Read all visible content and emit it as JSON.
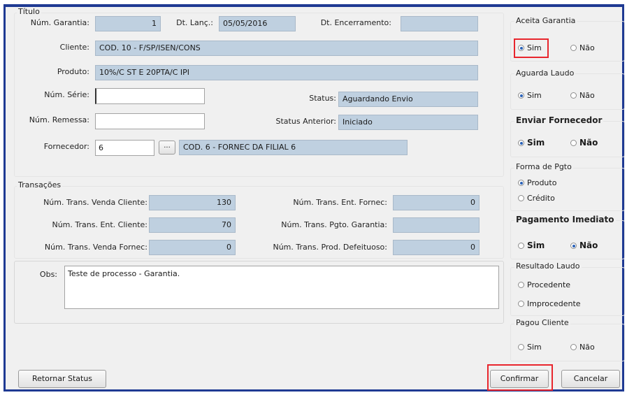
{
  "titulo": {
    "group_title": "Título",
    "num_garantia": {
      "label": "Núm. Garantia:",
      "value": "1"
    },
    "dt_lanc": {
      "label": "Dt. Lanç.:",
      "value": "05/05/2016"
    },
    "dt_encerramento": {
      "label": "Dt. Encerramento:",
      "value": ""
    },
    "cliente": {
      "label": "Cliente:",
      "value": "COD. 10 - F/SP/ISEN/CONS"
    },
    "produto": {
      "label": "Produto:",
      "value": "10%/C ST E 20PTA/C IPI"
    },
    "num_serie": {
      "label": "Núm. Série:",
      "value": ""
    },
    "status": {
      "label": "Status:",
      "value": "Aguardando Envio"
    },
    "num_remessa": {
      "label": "Núm. Remessa:",
      "value": ""
    },
    "status_anterior": {
      "label": "Status Anterior:",
      "value": "Iniciado"
    },
    "fornecedor": {
      "label": "Fornecedor:",
      "code": "6",
      "lookup_label": "...",
      "name": "COD. 6 - FORNEC DA FILIAL 6"
    }
  },
  "transacoes": {
    "group_title": "Transações",
    "venda_cliente": {
      "label": "Núm. Trans. Venda Cliente:",
      "value": "130"
    },
    "ent_cliente": {
      "label": "Núm. Trans. Ent. Cliente:",
      "value": "70"
    },
    "venda_fornec": {
      "label": "Núm. Trans. Venda Fornec:",
      "value": "0"
    },
    "ent_fornec": {
      "label": "Núm. Trans. Ent. Fornec:",
      "value": "0"
    },
    "pgto_garantia": {
      "label": "Núm. Trans. Pgto. Garantia:",
      "value": ""
    },
    "prod_defeituoso": {
      "label": "Núm. Trans. Prod. Defeituoso:",
      "value": "0"
    }
  },
  "obs": {
    "label": "Obs:",
    "value": "Teste de processo - Garantia."
  },
  "right_panel": {
    "aceita_garantia": {
      "title": "Aceita Garantia",
      "options": [
        "Sim",
        "Não"
      ],
      "selected": "Sim"
    },
    "aguarda_laudo": {
      "title": "Aguarda Laudo",
      "options": [
        "Sim",
        "Não"
      ],
      "selected": "Sim"
    },
    "enviar_fornecedor": {
      "title": "Enviar Fornecedor",
      "options": [
        "Sim",
        "Não"
      ],
      "selected": "Sim"
    },
    "forma_pgto": {
      "title": "Forma de Pgto",
      "options": [
        "Produto",
        "Crédito"
      ],
      "selected": "Produto"
    },
    "pagamento_imediato": {
      "title": "Pagamento Imediato",
      "options": [
        "Sim",
        "Não"
      ],
      "selected": "Não"
    },
    "resultado_laudo": {
      "title": "Resultado Laudo",
      "options": [
        "Procedente",
        "Improcedente"
      ],
      "selected": ""
    },
    "pagou_cliente": {
      "title": "Pagou Cliente",
      "options": [
        "Sim",
        "Não"
      ],
      "selected": ""
    }
  },
  "buttons": {
    "retornar_status": "Retornar Status",
    "confirmar": "Confirmar",
    "cancelar": "Cancelar"
  },
  "colors": {
    "readonly_field": "#bfd0e0",
    "highlight": "#e8262d",
    "frame": "#1f3a93",
    "radio_selected": "#2a62b8"
  }
}
